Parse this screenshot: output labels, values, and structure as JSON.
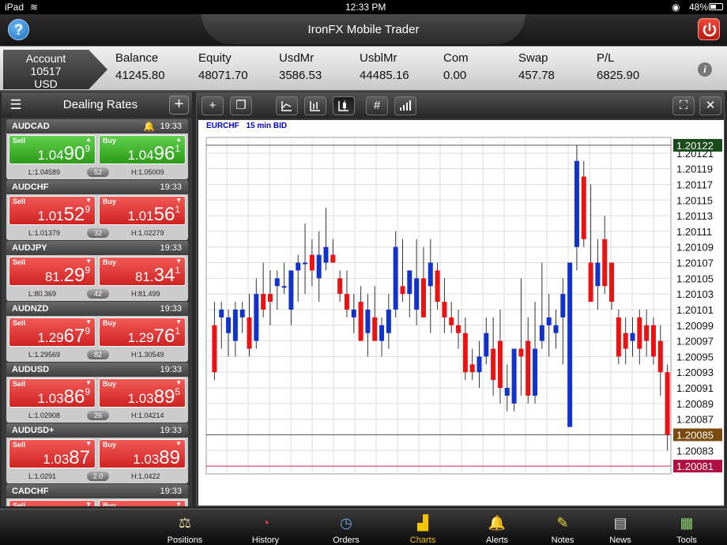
{
  "status": {
    "device": "iPad",
    "time": "12:33 PM",
    "battery": "48%"
  },
  "header": {
    "title": "IronFX Mobile Trader"
  },
  "account": {
    "label": "Account",
    "number": "10517",
    "currency": "USD",
    "stats": [
      {
        "label": "Balance",
        "value": "41245.80"
      },
      {
        "label": "Equity",
        "value": "48071.70"
      },
      {
        "label": "UsdMr",
        "value": "3586.53"
      },
      {
        "label": "UsblMr",
        "value": "44485.16"
      },
      {
        "label": "Com",
        "value": "0.00"
      },
      {
        "label": "Swap",
        "value": "457.78"
      },
      {
        "label": "P/L",
        "value": "6825.90"
      }
    ]
  },
  "dealing": {
    "title": "Dealing Rates",
    "side_labels": {
      "sell": "Sell",
      "buy": "Buy"
    },
    "rates": [
      {
        "symbol": "AUDCAD",
        "time": "19:33",
        "alert": true,
        "color": "green",
        "sell": {
          "pre": "1.04",
          "big": "90",
          "sup": "9"
        },
        "buy": {
          "pre": "1.04",
          "big": "96",
          "sup": "1"
        },
        "low": "L:1.04589",
        "spread": "52",
        "high": "H:1.05009"
      },
      {
        "symbol": "AUDCHF",
        "time": "19:33",
        "alert": false,
        "color": "red",
        "sell": {
          "pre": "1.01",
          "big": "52",
          "sup": "9"
        },
        "buy": {
          "pre": "1.01",
          "big": "56",
          "sup": "1"
        },
        "low": "L:1.01379",
        "spread": "32",
        "high": "H:1.02279"
      },
      {
        "symbol": "AUDJPY",
        "time": "19:33",
        "alert": false,
        "color": "red",
        "sell": {
          "pre": "81.",
          "big": "29",
          "sup": "9"
        },
        "buy": {
          "pre": "81.",
          "big": "34",
          "sup": "1"
        },
        "low": "L:80.369",
        "spread": "42",
        "high": "H:81.499"
      },
      {
        "symbol": "AUDNZD",
        "time": "19:33",
        "alert": false,
        "color": "red",
        "sell": {
          "pre": "1.29",
          "big": "67",
          "sup": "9"
        },
        "buy": {
          "pre": "1.29",
          "big": "76",
          "sup": "1"
        },
        "low": "L:1.29569",
        "spread": "82",
        "high": "H:1.30549"
      },
      {
        "symbol": "AUDUSD",
        "time": "19:33",
        "alert": false,
        "color": "red",
        "sell": {
          "pre": "1.03",
          "big": "86",
          "sup": "9"
        },
        "buy": {
          "pre": "1.03",
          "big": "89",
          "sup": "5"
        },
        "low": "L:1.02908",
        "spread": "26",
        "high": "H:1.04214"
      },
      {
        "symbol": "AUDUSD+",
        "time": "19:33",
        "alert": false,
        "color": "red",
        "sell": {
          "pre": "1.03",
          "big": "87",
          "sup": ""
        },
        "buy": {
          "pre": "1.03",
          "big": "89",
          "sup": ""
        },
        "low": "L:1.0291",
        "spread": "2.0",
        "high": "H:1.0422"
      },
      {
        "symbol": "CADCHF",
        "time": "19:33",
        "alert": false,
        "color": "red",
        "sell": {
          "pre": "",
          "big": "",
          "sup": ""
        },
        "buy": {
          "pre": "",
          "big": "",
          "sup": ""
        },
        "low": "",
        "spread": "",
        "high": ""
      }
    ]
  },
  "chart_toolbar": [
    {
      "icon": "plus-icon",
      "glyph": "+"
    },
    {
      "icon": "copy-icon",
      "glyph": "❐"
    },
    {
      "icon": "line-chart-icon",
      "glyph": "⌊"
    },
    {
      "icon": "bar-chart-icon",
      "glyph": "┼"
    },
    {
      "icon": "candle-chart-icon",
      "glyph": "▮"
    },
    {
      "icon": "grid-icon",
      "glyph": "#"
    },
    {
      "icon": "volume-icon",
      "glyph": "▁▃▅▇"
    },
    {
      "icon": "fullscreen-icon",
      "glyph": "⛶"
    },
    {
      "icon": "close-icon",
      "glyph": "✕"
    }
  ],
  "chart_data": {
    "type": "candlestick",
    "title": "EURCHF",
    "timeframe": "15 min BID",
    "ylim": [
      1.2008,
      1.20123
    ],
    "y_ticks": [
      "1.20121",
      "1.20119",
      "1.20117",
      "1.20115",
      "1.20113",
      "1.20111",
      "1.20109",
      "1.20107",
      "1.20105",
      "1.20103",
      "1.20101",
      "1.20099",
      "1.20097",
      "1.20095",
      "1.20093",
      "1.20091",
      "1.20089",
      "1.20087",
      "1.20083"
    ],
    "current_high": "1.20122",
    "current_price": "1.20085",
    "current_low": "1.20081",
    "colors": {
      "up": "#1133cc",
      "down": "#ee1111",
      "wick": "#333333",
      "grid": "#dddddd"
    },
    "candles": [
      [
        1.20099,
        1.20102,
        1.20092,
        1.20093
      ],
      [
        1.201,
        1.20102,
        1.20096,
        1.20101
      ],
      [
        1.20098,
        1.20101,
        1.20095,
        1.201
      ],
      [
        1.20097,
        1.20102,
        1.20095,
        1.20101
      ],
      [
        1.201,
        1.20102,
        1.20098,
        1.20101
      ],
      [
        1.201,
        1.20103,
        1.20095,
        1.20096
      ],
      [
        1.20097,
        1.20105,
        1.20096,
        1.20103
      ],
      [
        1.20103,
        1.20107,
        1.201,
        1.20101
      ],
      [
        1.20103,
        1.20106,
        1.20099,
        1.20102
      ],
      [
        1.20104,
        1.20106,
        1.20101,
        1.20105
      ],
      [
        1.20104,
        1.20107,
        1.20103,
        1.20104
      ],
      [
        1.20101,
        1.20106,
        1.20099,
        1.20106
      ],
      [
        1.20106,
        1.20108,
        1.20102,
        1.20107
      ],
      [
        1.20107,
        1.20112,
        1.20103,
        1.20107
      ],
      [
        1.20108,
        1.2011,
        1.20104,
        1.20106
      ],
      [
        1.20105,
        1.20111,
        1.20102,
        1.20108
      ],
      [
        1.20107,
        1.20114,
        1.20106,
        1.20109
      ],
      [
        1.20108,
        1.2011,
        1.20107,
        1.20107
      ],
      [
        1.20105,
        1.20106,
        1.20102,
        1.20103
      ],
      [
        1.20103,
        1.20106,
        1.201,
        1.20101
      ],
      [
        1.201,
        1.20103,
        1.20098,
        1.20101
      ],
      [
        1.20102,
        1.20104,
        1.20099,
        1.20097
      ],
      [
        1.20098,
        1.20103,
        1.20095,
        1.20101
      ],
      [
        1.201,
        1.20104,
        1.20098,
        1.20097
      ],
      [
        1.20097,
        1.201,
        1.20095,
        1.20099
      ],
      [
        1.20098,
        1.20103,
        1.20096,
        1.20101
      ],
      [
        1.20101,
        1.20111,
        1.201,
        1.20109
      ],
      [
        1.20104,
        1.2011,
        1.20102,
        1.20103
      ],
      [
        1.20103,
        1.20106,
        1.201,
        1.20106
      ],
      [
        1.20101,
        1.2011,
        1.20099,
        1.20105
      ],
      [
        1.20105,
        1.20109,
        1.20103,
        1.201
      ],
      [
        1.20104,
        1.2011,
        1.20098,
        1.20107
      ],
      [
        1.20106,
        1.20107,
        1.20101,
        1.20102
      ],
      [
        1.20102,
        1.20105,
        1.20098,
        1.201
      ],
      [
        1.201,
        1.20102,
        1.20098,
        1.20099
      ],
      [
        1.20099,
        1.20101,
        1.20096,
        1.20098
      ],
      [
        1.20098,
        1.201,
        1.20092,
        1.20093
      ],
      [
        1.20094,
        1.20096,
        1.20092,
        1.20093
      ],
      [
        1.20093,
        1.20097,
        1.20091,
        1.20095
      ],
      [
        1.20095,
        1.201,
        1.20094,
        1.20098
      ],
      [
        1.20096,
        1.201,
        1.2009,
        1.20092
      ],
      [
        1.20097,
        1.20101,
        1.20089,
        1.20091
      ],
      [
        1.2009,
        1.20094,
        1.20088,
        1.20091
      ],
      [
        1.20089,
        1.20096,
        1.20088,
        1.20096
      ],
      [
        1.20096,
        1.20105,
        1.2009,
        1.20095
      ],
      [
        1.20097,
        1.201,
        1.20089,
        1.2009
      ],
      [
        1.2009,
        1.20102,
        1.20089,
        1.20096
      ],
      [
        1.20097,
        1.20107,
        1.20096,
        1.20099
      ],
      [
        1.20099,
        1.20103,
        1.20095,
        1.201
      ],
      [
        1.20098,
        1.20101,
        1.20096,
        1.20099
      ],
      [
        1.201,
        1.20105,
        1.20094,
        1.20103
      ],
      [
        1.20086,
        1.20107,
        1.20086,
        1.20107
      ],
      [
        1.20109,
        1.20122,
        1.20106,
        1.2012
      ],
      [
        1.20118,
        1.2012,
        1.20109,
        1.2011
      ],
      [
        1.20107,
        1.20117,
        1.20103,
        1.20102
      ],
      [
        1.20104,
        1.2011,
        1.20101,
        1.20107
      ],
      [
        1.2011,
        1.20113,
        1.20103,
        1.20104
      ],
      [
        1.20107,
        1.20106,
        1.20101,
        1.20102
      ],
      [
        1.201,
        1.20101,
        1.20094,
        1.20095
      ],
      [
        1.20098,
        1.201,
        1.20094,
        1.20096
      ],
      [
        1.20097,
        1.201,
        1.20095,
        1.20098
      ],
      [
        1.201,
        1.20101,
        1.20094,
        1.20096
      ],
      [
        1.20099,
        1.20101,
        1.20095,
        1.20097
      ],
      [
        1.20099,
        1.201,
        1.20094,
        1.20095
      ],
      [
        1.20097,
        1.20099,
        1.2009,
        1.20093
      ],
      [
        1.20093,
        1.20094,
        1.20083,
        1.20085
      ]
    ]
  },
  "tabs": [
    {
      "label": "Positions",
      "icon": "positions-icon",
      "glyph": "⚖",
      "color": "#e8d8a8"
    },
    {
      "label": "History",
      "icon": "history-icon",
      "glyph": "◔",
      "color": "#d04040"
    },
    {
      "label": "Orders",
      "icon": "orders-icon",
      "glyph": "◷",
      "color": "#6aa8e8"
    },
    {
      "label": "Charts",
      "icon": "charts-icon",
      "glyph": "▟",
      "color": "#f2c400",
      "active": true
    },
    {
      "label": "Alerts",
      "icon": "bell-icon",
      "glyph": "🔔",
      "color": "#f5a800"
    },
    {
      "label": "Notes",
      "icon": "notes-icon",
      "glyph": "✎",
      "color": "#f2dd30"
    },
    {
      "label": "News",
      "icon": "news-icon",
      "glyph": "▤",
      "color": "#dddddd"
    },
    {
      "label": "Tools",
      "icon": "tools-icon",
      "glyph": "▦",
      "color": "#8cd070"
    }
  ]
}
